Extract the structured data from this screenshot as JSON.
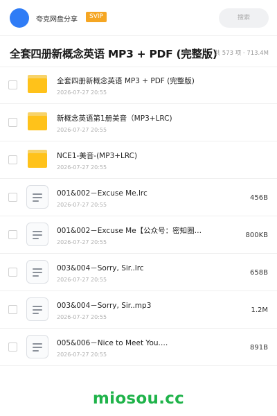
{
  "header": {
    "site_name": "夸克网盘分享",
    "badge": "SVIP",
    "search_placeholder": "搜索"
  },
  "folder_title": "全套四册新概念英语 MP3 + PDF (完整版)",
  "summary": "共 573 项 · 713.4M",
  "files": [
    {
      "name": "全套四册新概念英语 MP3 + PDF (完整版)",
      "date": "2026-07-27 20:55",
      "size": "",
      "type": "folder-icon"
    },
    {
      "name": "新概念英语第1册美音（MP3+LRC)",
      "date": "2026-07-27 20:55",
      "size": "",
      "type": "folder-icon"
    },
    {
      "name": "NCE1-美音-(MP3+LRC)",
      "date": "2026-07-27 20:55",
      "size": "",
      "type": "folder-icon"
    },
    {
      "name": "001&002－Excuse Me.lrc",
      "date": "2026-07-27 20:55",
      "size": "456B",
      "type": "document-icon"
    },
    {
      "name": "001&002－Excuse Me【公众号：密知圈…",
      "date": "2026-07-27 20:55",
      "size": "800KB",
      "type": "document-icon"
    },
    {
      "name": "003&004－Sorry, Sir..lrc",
      "date": "2026-07-27 20:55",
      "size": "658B",
      "type": "document-icon"
    },
    {
      "name": "003&004－Sorry, Sir..mp3",
      "date": "2026-07-27 20:55",
      "size": "1.2M",
      "type": "document-icon"
    },
    {
      "name": "005&006－Nice to Meet You.…",
      "date": "2026-07-27 20:55",
      "size": "891B",
      "type": "document-icon"
    }
  ],
  "watermark": "miosou.cc",
  "colors": {
    "avatar": "#2f7cf6",
    "badge": "#f5a623",
    "folder": "#ffc21a",
    "watermark": "#1fb34a"
  }
}
